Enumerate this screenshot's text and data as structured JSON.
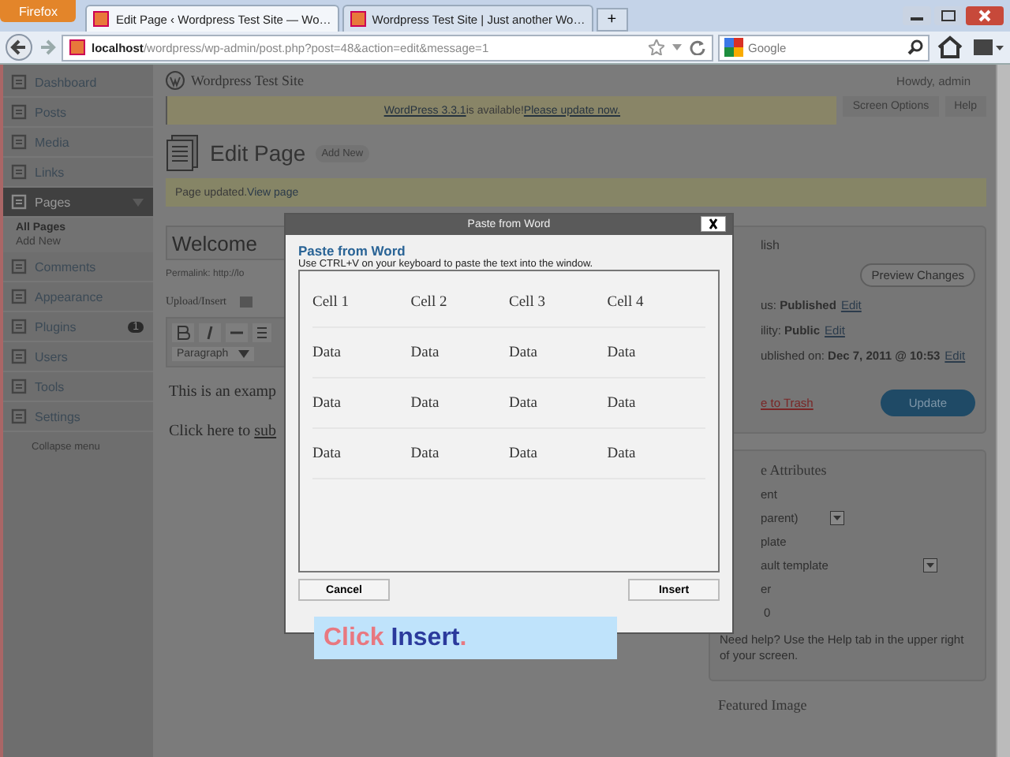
{
  "browser": {
    "app_button": "Firefox",
    "tabs": [
      {
        "title": "Edit Page ‹ Wordpress Test Site — Wo…",
        "selected": true
      },
      {
        "title": "Wordpress Test Site | Just another Wo…",
        "selected": false
      }
    ],
    "new_tab": "+",
    "url_host": "localhost",
    "url_path": "/wordpress/wp-admin/post.php?post=48&action=edit&message=1",
    "search_placeholder": "Google"
  },
  "header": {
    "site_title": "Wordpress Test Site",
    "howdy": "Howdy, admin"
  },
  "update_notice": {
    "link": "WordPress 3.3.1",
    "text": " is available! ",
    "action": "Please update now."
  },
  "screen_options": "Screen Options",
  "help": "Help",
  "heading": {
    "title": "Edit Page",
    "add_new": "Add New"
  },
  "updated_notice": {
    "text": "Page updated. ",
    "link": "View page"
  },
  "sidebar": {
    "items": [
      {
        "label": "Dashboard",
        "selected": false
      },
      {
        "label": "Posts",
        "selected": false
      },
      {
        "label": "Media",
        "selected": false
      },
      {
        "label": "Links",
        "selected": false
      },
      {
        "label": "Pages",
        "selected": true,
        "expanded": true,
        "children": [
          {
            "label": "All Pages",
            "selected": true
          },
          {
            "label": "Add New",
            "selected": false
          }
        ]
      },
      {
        "label": "Comments",
        "selected": false
      },
      {
        "label": "Appearance",
        "selected": false
      },
      {
        "label": "Plugins",
        "selected": false,
        "badge": "1"
      },
      {
        "label": "Users",
        "selected": false
      },
      {
        "label": "Tools",
        "selected": false
      },
      {
        "label": "Settings",
        "selected": false
      }
    ],
    "collapse": "Collapse menu"
  },
  "editor": {
    "title": "Welcome",
    "permalink": "Permalink: http://lo",
    "upload": "Upload/Insert",
    "format_select": "Paragraph",
    "lines": [
      "This is an examp"
    ],
    "link_prefix": "Click here to ",
    "link": "sub"
  },
  "dialog": {
    "title": "Paste from Word",
    "heading": "Paste from Word",
    "instruction": "Use CTRL+V on your keyboard to paste the text into the window.",
    "table": [
      [
        "Cell 1",
        "Cell 2",
        "Cell 3",
        "Cell 4"
      ],
      [
        "Data",
        "Data",
        "Data",
        "Data"
      ],
      [
        "Data",
        "Data",
        "Data",
        "Data"
      ],
      [
        "Data",
        "Data",
        "Data",
        "Data"
      ]
    ],
    "buttons": [
      "Cancel",
      "Insert"
    ]
  },
  "callout": {
    "parts": [
      {
        "text": "Click ",
        "color": "#e87880"
      },
      {
        "text": "Insert",
        "color": "#2b3a9c"
      },
      {
        "text": ".",
        "color": "#e87880"
      }
    ]
  },
  "publish": {
    "title": "lish",
    "preview": "Preview Changes",
    "status": "us: **Published**",
    "status_link": "Edit",
    "visibility": "ility: **Public**",
    "visibility_link": "Edit",
    "published": "ublished on: **Dec 7, 2011 @ 10:53**",
    "published_link": "Edit",
    "trash": "e to Trash",
    "update": "Update"
  },
  "attributes": {
    "title": "e Attributes",
    "parent_label": "ent",
    "parent_value": "parent)",
    "template_label": "plate",
    "template_value": "ault template",
    "order_label": "er",
    "order_value": "0",
    "help": "Need help? Use the Help tab in the upper right of your screen."
  },
  "featured": {
    "title": "Featured Image"
  }
}
